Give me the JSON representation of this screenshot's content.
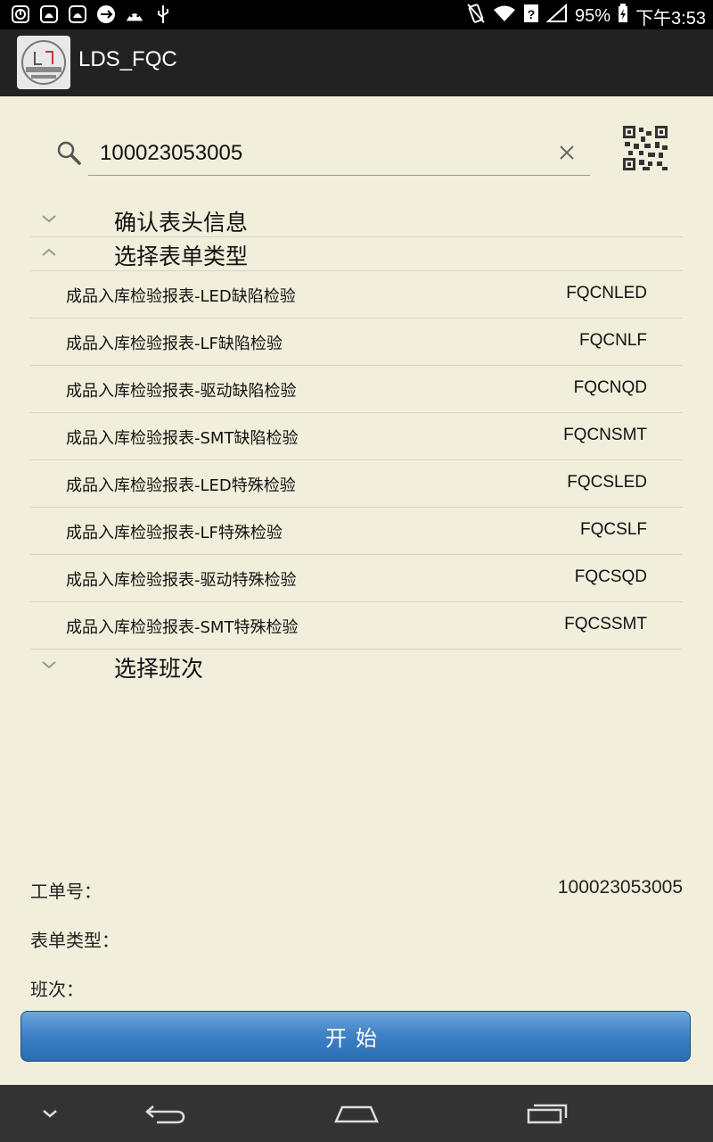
{
  "status_bar": {
    "battery": "95%",
    "time": "下午3:53",
    "left_icons": [
      "notification-icon",
      "android-debug-icon",
      "android-debug-icon",
      "usb-sync-icon",
      "android-icon",
      "usb-icon"
    ],
    "right_icons": [
      "vibrate-icon",
      "wifi-icon",
      "signal-unknown-icon",
      "cell-signal-icon",
      "battery-charging-icon"
    ]
  },
  "app_bar": {
    "title": "LDS_FQC",
    "logo_icon": "leedarson-logo"
  },
  "search": {
    "value": "100023053005",
    "search_icon": "search-icon",
    "clear_icon": "close-icon",
    "scan_icon": "qr-code-icon"
  },
  "sections": [
    {
      "title": "确认表头信息",
      "expanded": false
    },
    {
      "title": "选择表单类型",
      "expanded": true
    },
    {
      "title": "选择班次",
      "expanded": false
    }
  ],
  "form_types": [
    {
      "label": "成品入库检验报表-LED缺陷检验",
      "code": "FQCNLED"
    },
    {
      "label": "成品入库检验报表-LF缺陷检验",
      "code": "FQCNLF"
    },
    {
      "label": "成品入库检验报表-驱动缺陷检验",
      "code": "FQCNQD"
    },
    {
      "label": "成品入库检验报表-SMT缺陷检验",
      "code": "FQCNSMT"
    },
    {
      "label": "成品入库检验报表-LED特殊检验",
      "code": "FQCSLED"
    },
    {
      "label": "成品入库检验报表-LF特殊检验",
      "code": "FQCSLF"
    },
    {
      "label": "成品入库检验报表-驱动特殊检验",
      "code": "FQCSQD"
    },
    {
      "label": "成品入库检验报表-SMT特殊检验",
      "code": "FQCSSMT"
    }
  ],
  "summary": {
    "work_order_label": "工单号：",
    "work_order_value": "100023053005",
    "form_type_label": "表单类型：",
    "shift_label": "班次："
  },
  "start_button": "开始",
  "colors": {
    "background": "#f1eedb",
    "button_blue": "#3f82c8",
    "app_bar": "#222222"
  }
}
